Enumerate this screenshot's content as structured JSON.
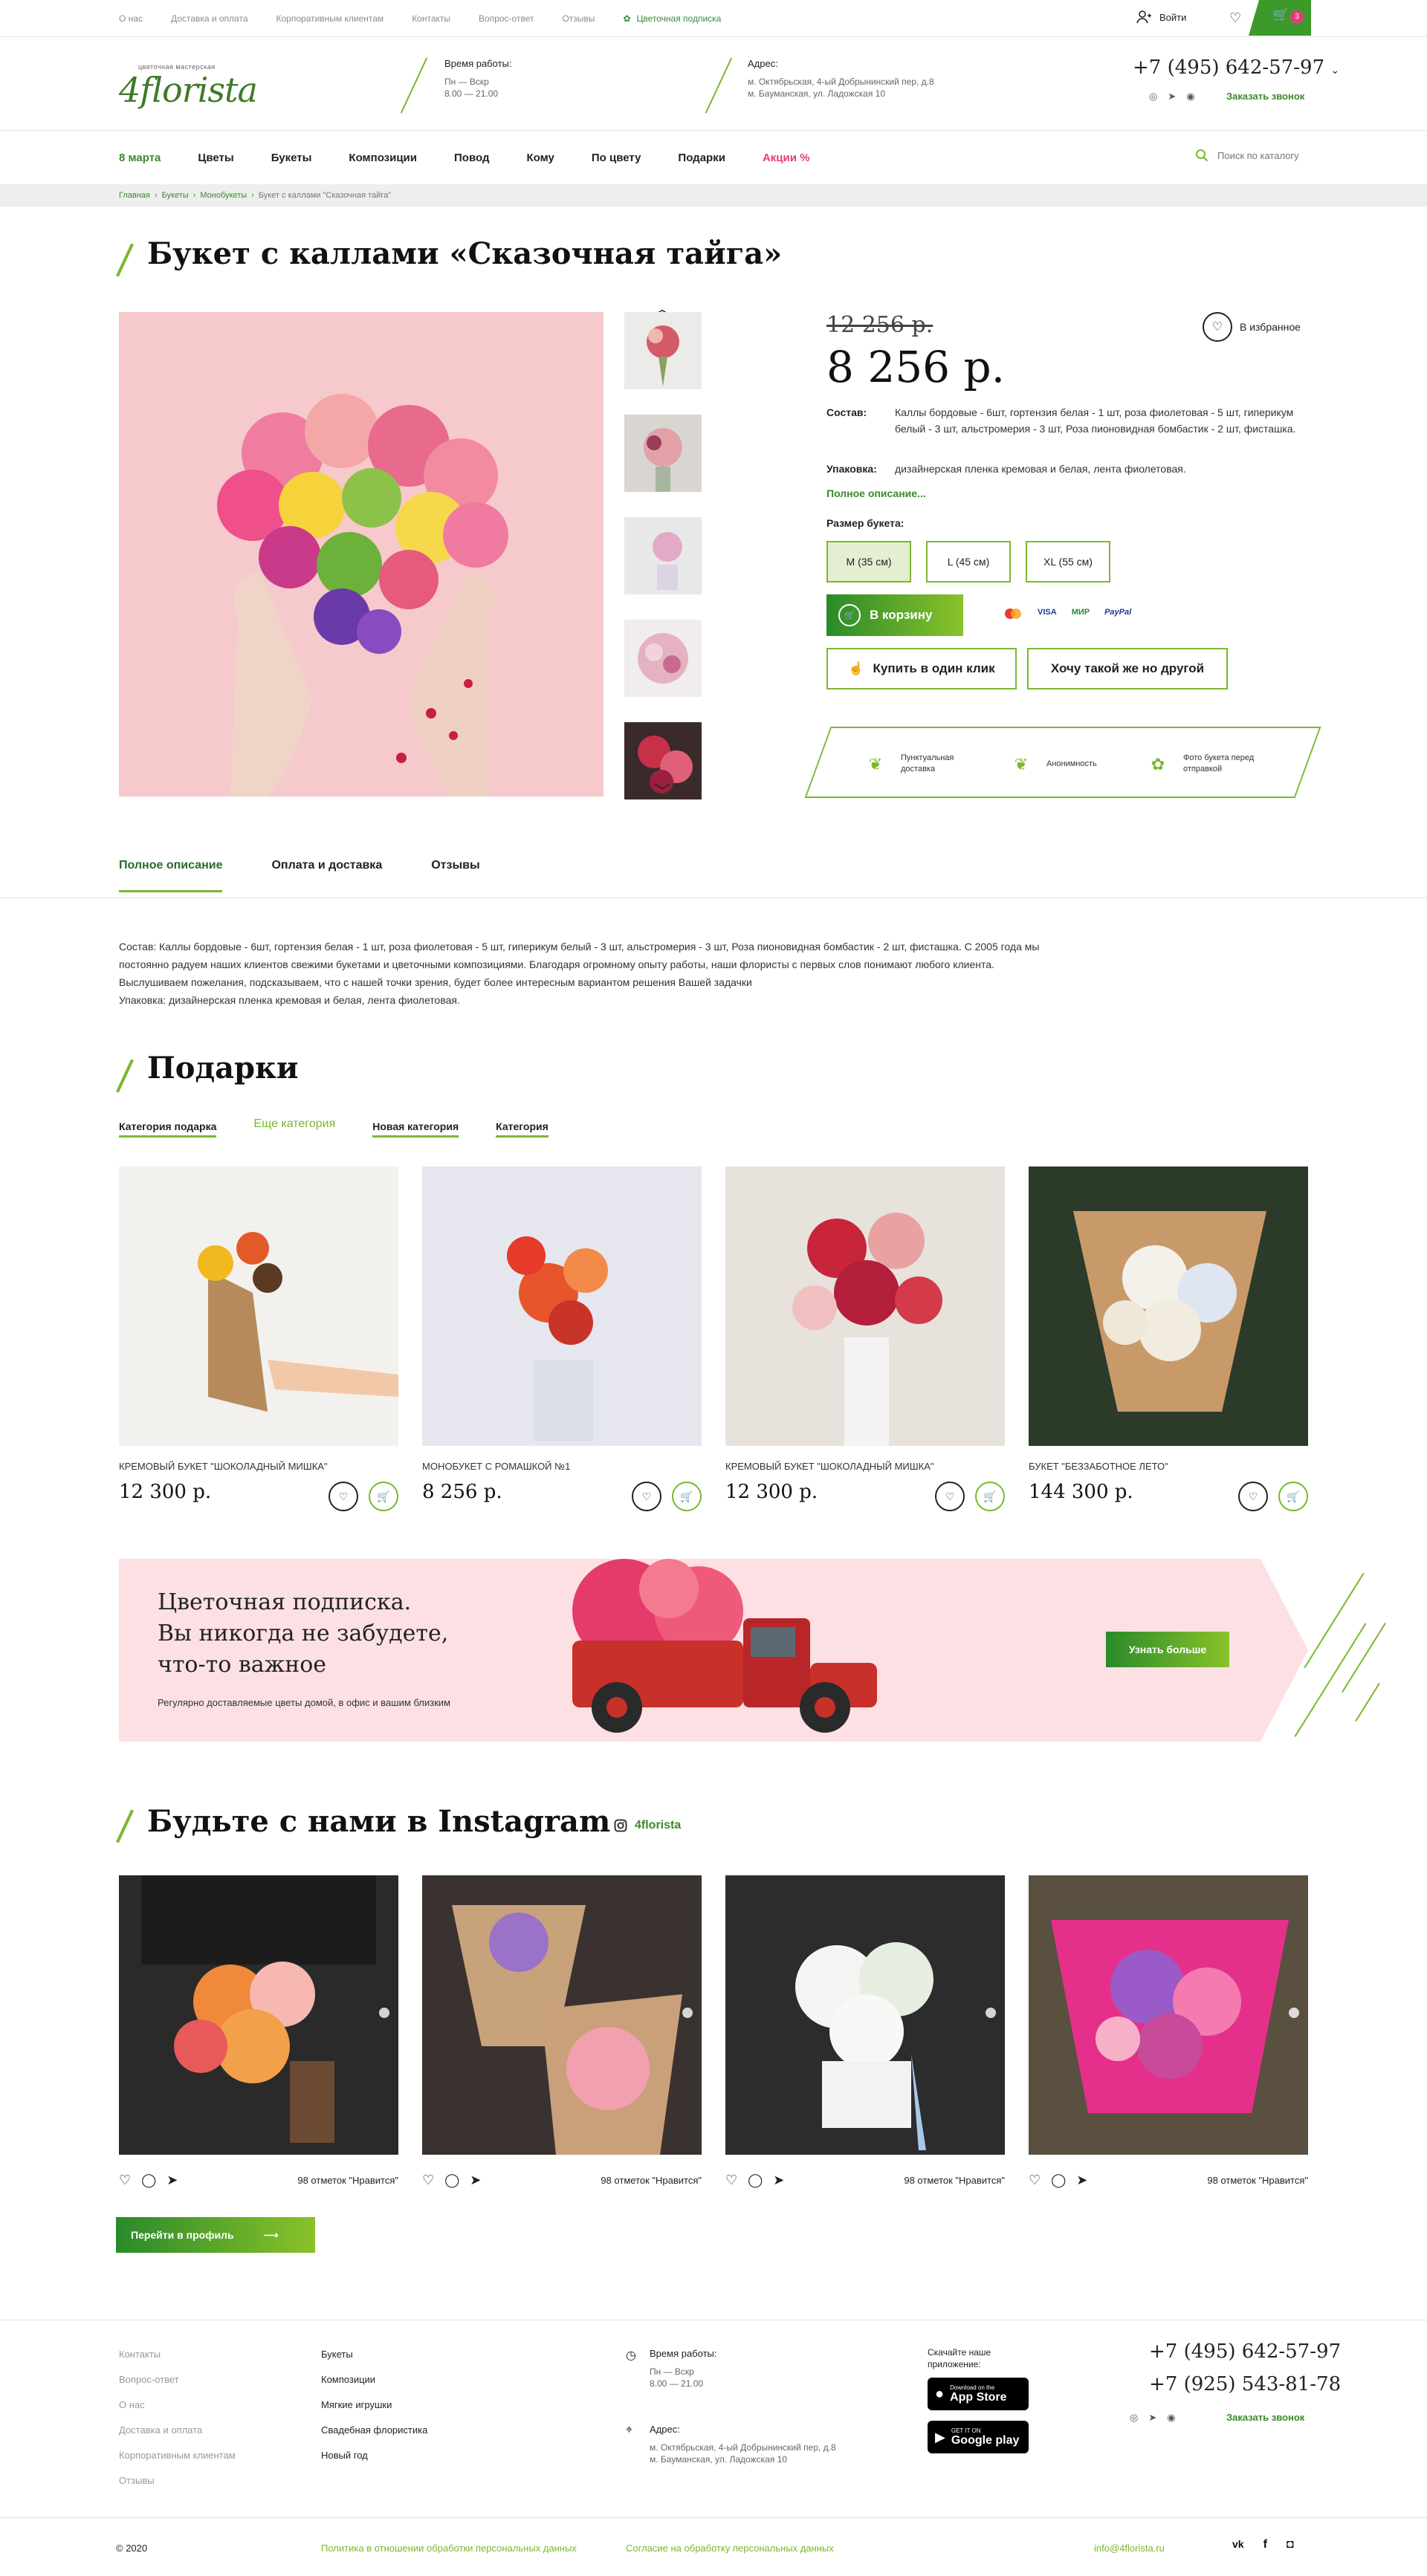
{
  "topbar": {
    "links": [
      "О нас",
      "Доставка и оплата",
      "Корпоративным клиентам",
      "Контакты",
      "Вопрос-ответ",
      "Отзывы"
    ],
    "subscription": "Цветочная подписка",
    "login": "Войти",
    "cart_count": "3"
  },
  "header": {
    "logo_tagline": "цветочная мастерская",
    "logo_text": "4florista",
    "hours_title": "Время работы:",
    "hours_days": "Пн — Вскр",
    "hours_time": "8.00 — 21.00",
    "address_title": "Адрес:",
    "address_1": "м. Октябрьская, 4-ый Добрынинский пер, д.8",
    "address_2": "м. Бауманская, ул. Ладожская 10",
    "phone": "+7 (495) 642-57-97",
    "callback": "Заказать звонок"
  },
  "nav": {
    "items": [
      "8 марта",
      "Цветы",
      "Букеты",
      "Композиции",
      "Повод",
      "Кому",
      "По цвету",
      "Подарки",
      "Акции %"
    ],
    "search_placeholder": "Поиск по каталогу"
  },
  "breadcrumbs": [
    "Главная",
    "Букеты",
    "Монобукеты",
    "Букет с каллами \"Сказочная тайга\""
  ],
  "product": {
    "title": "Букет с каллами «Сказочная тайга»",
    "old_price": "12 256 р.",
    "price": "8 256 р.",
    "favorite": "В избранное",
    "composition_label": "Состав:",
    "composition": "Каллы бордовые - 6шт, гортензия белая - 1 шт, роза фиолетовая - 5 шт, гиперикум белый - 3 шт, альстромерия - 3 шт,  Роза пионовидная бомбастик - 2 шт, фисташка.",
    "packaging_label": "Упаковка:",
    "packaging": "дизайнерская пленка кремовая и белая, лента фиолетовая.",
    "full_desc_link": "Полное описание...",
    "size_label": "Размер букета:",
    "sizes": [
      "M (35 см)",
      "L (45 см)",
      "XL (55 см)"
    ],
    "selected_size": "M (35 см)",
    "cart_button": "В корзину",
    "pay_methods": [
      "VISA",
      "МИР",
      "PayPal"
    ],
    "one_click": "Купить в один клик",
    "want_other": "Хочу такой же но другой",
    "benefits": [
      "Пунктуальная доставка",
      "Анонимность",
      "Фото букета перед отправкой"
    ]
  },
  "tabs": {
    "items": [
      "Полное описание",
      "Оплата и доставка",
      "Отзывы"
    ],
    "active": "Полное описание"
  },
  "description": {
    "line1": "Состав: Каллы бордовые - 6шт, гортензия белая - 1 шт, роза фиолетовая - 5 шт, гиперикум белый - 3 шт, альстромерия - 3 шт,  Роза пионовидная бомбастик - 2 шт, фисташка. С 2005 года мы постоянно радуем наших клиентов свежими букетами и цветочными композициями. Благодаря огромному опыту работы, наши флористы с первых слов понимают любого клиента. Выслушиваем пожелания, подсказываем, что с нашей точки зрения, будет более интересным вариантом решения Вашей задачки",
    "line2": "Упаковка: дизайнерская пленка кремовая и белая, лента фиолетовая."
  },
  "gifts": {
    "title": "Подарки",
    "categories": [
      "Категория подарка",
      "Еще категория",
      "Новая категория",
      "Категория"
    ],
    "cards": [
      {
        "name": "КРЕМОВЫЙ БУКЕТ \"ШОКОЛАДНЫЙ МИШКА\"",
        "price": "12 300 р."
      },
      {
        "name": "МОНОБУКЕТ С РОМАШКОЙ №1",
        "price": "8 256 р."
      },
      {
        "name": "КРЕМОВЫЙ БУКЕТ \"ШОКОЛАДНЫЙ МИШКА\"",
        "price": "12 300 р."
      },
      {
        "name": "БУКЕТ \"БЕЗЗАБОТНОЕ ЛЕТО\"",
        "price": "144 300 р."
      }
    ]
  },
  "banner": {
    "line1": "Цветочная подписка.",
    "line2": "Вы никогда не забудете,",
    "line3": "что-то важное",
    "sub": "Регулярно доставляемые цветы домой, в офис и вашим близким",
    "button": "Узнать больше"
  },
  "instagram": {
    "title": "Будьте с нами в Instagram",
    "handle": "4florista",
    "likes": "98 отметок \"Нравится\"",
    "profile_button": "Перейти в профиль"
  },
  "footer": {
    "col1": [
      "Контакты",
      "Вопрос-ответ",
      "О нас",
      "Доставка и оплата",
      "Корпоративным клиентам",
      "Отзывы"
    ],
    "col2": [
      "Букеты",
      "Композиции",
      "Мягкие игрушки",
      "Свадебная флористика",
      "Новый год"
    ],
    "hours_title": "Время работы:",
    "hours_days": "Пн — Вскр",
    "hours_time": "8.00 — 21.00",
    "address_title": "Адрес:",
    "address_1": "м. Октябрьская, 4-ый Добрынинский пер, д.8",
    "address_2": "м. Бауманская, ул. Ладожская 10",
    "app_title": "Скачайте наше приложение:",
    "app_store_small": "Download on the",
    "app_store": "App Store",
    "google_small": "GET IT ON",
    "google": "Google play",
    "phone1": "+7 (495) 642-57-97",
    "phone2": "+7 (925) 543-81-78",
    "callback": "Заказать звонок",
    "copyright": "© 2020",
    "policy1": "Политика в отношении обработки персональных данных",
    "policy2": "Согласие на обработку персональных данных",
    "email": "info@4florista.ru"
  },
  "colors": {
    "brand_green": "#3a8a2a",
    "accent_lime": "#7ab82e",
    "sale_pink": "#e43b83"
  }
}
